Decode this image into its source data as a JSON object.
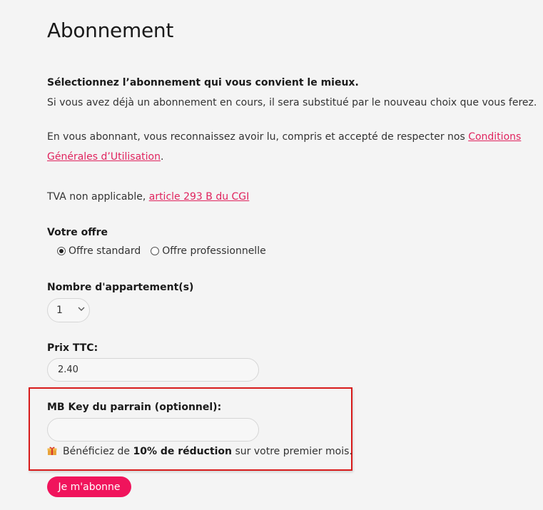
{
  "page": {
    "title": "Abonnement"
  },
  "intro": {
    "heading": "Sélectionnez l’abonnement qui vous convient le mieux.",
    "line1": "Si vous avez déjà un abonnement en cours, il sera substitué par le nouveau choix que vous ferez.",
    "terms_prefix": "En vous abonnant, vous reconnaissez avoir lu, compris et accepté de respecter nos ",
    "terms_link_part1": "Conditions",
    "terms_link_part2": "Générales d’Utilisation",
    "terms_suffix": ".",
    "tva_prefix": "TVA non applicable, ",
    "tva_link": "article 293 B du CGI"
  },
  "offer": {
    "label": "Votre offre",
    "options": [
      {
        "label": "Offre standard",
        "checked": true
      },
      {
        "label": "Offre professionnelle",
        "checked": false
      }
    ]
  },
  "apartments": {
    "label": "Nombre d'appartement(s)",
    "selected": "1"
  },
  "price": {
    "label": "Prix TTC:",
    "value": "2.40"
  },
  "referral": {
    "label": "MB Key du parrain (optionnel):",
    "value": "",
    "note_prefix": "Bénéficiez de ",
    "note_bold": "10% de réduction",
    "note_suffix": " sur votre premier mois."
  },
  "submit": {
    "label": "Je m'abonne"
  },
  "colors": {
    "accent": "#f0145c",
    "link": "#e0245e",
    "highlight_border": "#d81b1b"
  },
  "icons": {
    "gift": "gift-icon",
    "chevron": "chevron-down-icon"
  }
}
